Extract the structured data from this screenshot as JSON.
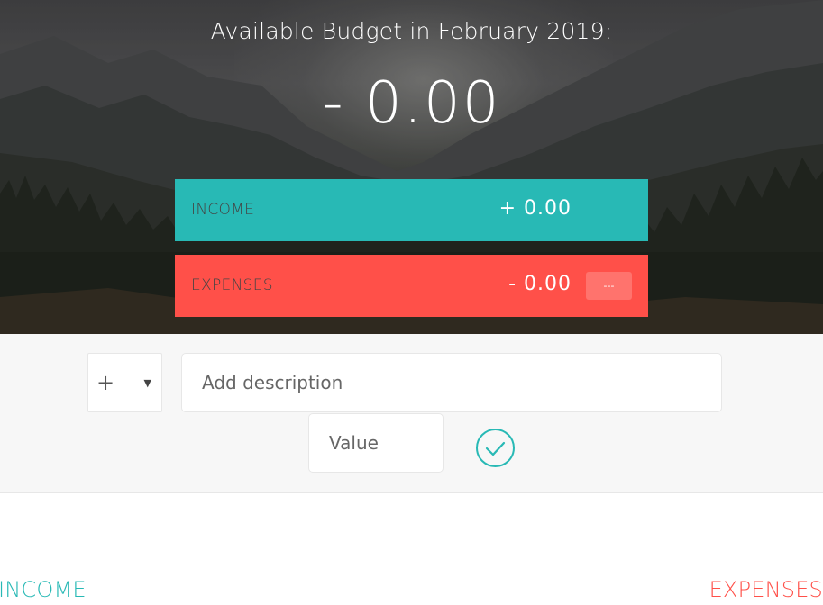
{
  "header": {
    "title": "Available Budget in February 2019:",
    "budget": "- 0.00"
  },
  "summary": {
    "income": {
      "label": "INCOME",
      "value": "+ 0.00"
    },
    "expenses": {
      "label": "EXPENSES",
      "value": "- 0.00",
      "percentage": "---"
    }
  },
  "add_bar": {
    "type_symbol": "+",
    "caret": "▼",
    "description_placeholder": "Add description",
    "value_placeholder": "Value",
    "submit_icon": "check-circle-icon"
  },
  "lists": {
    "income_title": "INCOME",
    "expenses_title": "EXPENSES"
  },
  "colors": {
    "income": "#28b9b5",
    "expenses": "#ff5049"
  }
}
